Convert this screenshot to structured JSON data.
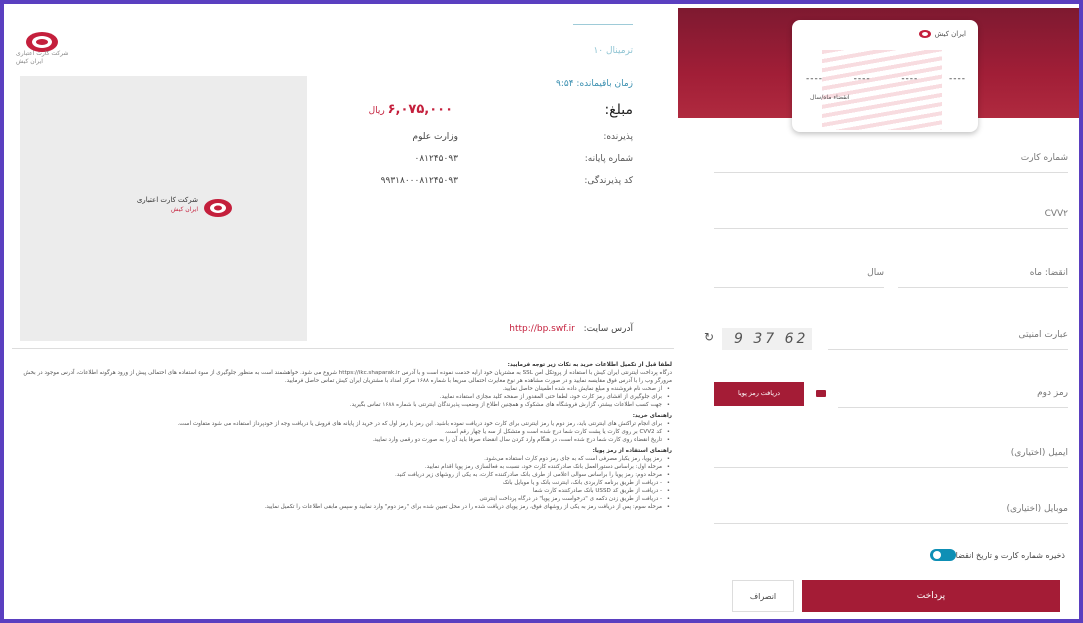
{
  "colors": {
    "brand": "#a41c36",
    "accent": "#0e8fb5",
    "frame": "#5a3fc0"
  },
  "header": {
    "company_lines": [
      "شرکت کارت اعتباری",
      "ایران کیش"
    ]
  },
  "info": {
    "terminal_hint": "ترمینال ۱۰",
    "timer_label": "زمان باقیمانده: ۹:۵۴",
    "amount_label": "مبلغ:",
    "amount_value": "۶,۰۷۵,۰۰۰",
    "amount_unit": "ریال",
    "rows": [
      {
        "label": "پذیرنده:",
        "value": "وزارت علوم"
      },
      {
        "label": "شماره پایانه:",
        "value": "۰۸۱۲۴۵۰۹۳"
      },
      {
        "label": "کد پذیرندگی:",
        "value": "۹۹۳۱۸۰۰۰۸۱۲۴۵۰۹۳"
      }
    ],
    "site_label": "آدرس سایت:",
    "site_url": "http://bp.swf.ir"
  },
  "merchant": {
    "name": "شرکت کارت اعتباری",
    "sub": "ایران کیش"
  },
  "guide": {
    "intro": "لطفا قبل از تکمیل اطلاعات خرید به نکات زیر توجه فرمایید:",
    "p1": "درگاه پرداخت اینترنتی ایران کیش با استفاده از پروتکل امن SSL به مشتریان خود ارایه خدمت نموده است و با آدرس https://ikc.shaparak.ir شروع می شود. خواهشمند است به منظور جلوگیری از سوء استفاده های احتمالی پیش از ورود هرگونه اطلاعات، آدرس موجود در بخش مرورگر وب را با آدرس فوق مقایسه نمایید و در صورت مشاهده هر نوع مغایرت احتمالی سریعا با شماره ۱۶۸۸ مرکز امداد با مشتریان ایران کیش تماس حاصل فرمایید.",
    "bullets1": [
      "از صحت نام فروشنده و مبلغ نمایش داده شده اطمینان حاصل نمایید.",
      "برای جلوگیری از افشای رمز کارت خود، لطفا حتی المقدور از صفحه کلید مجازی استفاده نمایید.",
      "جهت کسب اطلاعات بیشتر، گزارش فروشگاه های مشکوک و همچنین اطلاع از وضعیت پذیرندگان اینترنتی با شماره ۱۶۸۸ تماس بگیرید."
    ],
    "head2": "راهنمای خرید:",
    "bullets2": [
      "برای انجام تراکنش های اینترنتی باید، رمز دوم یا رمز اینترنتی برای کارت خود دریافت نموده باشید. این رمز با رمز اول که در خرید از پایانه های فروش یا دریافت وجه از خودپرداز استفاده می شود متفاوت است.",
      "کد CVV2 بر روی کارت یا پشت کارت شما درج شده است و متشکل از سه یا چهار رقم است.",
      "تاریخ انقضاء روی کارت شما درج شده است، در هنگام وارد کردن سال انقضاء صرفا باید آن را به صورت دو رقمی وارد نمایید."
    ],
    "head3": "راهنمای استفاده از رمز پویا:",
    "bullets3": [
      "رمز پویا، رمز یکبار مصرفی است که به جای رمز دوم کارت استفاده می‌شود.",
      "مرحله اول: براساس دستورالعمل بانک صادرکننده کارت خود، نسبت به فعالسازی رمز پویا اقدام نمایید.",
      "مرحله دوم: رمز پویا را براساس سوالی اعلامی از طرف بانک صادرکننده کارت، به یکی از روشهای زیر دریافت کنید.",
      "- دریافت از طریق برنامه کاربردی بانک، اینترنت بانک و یا موبایل بانک",
      "- دریافت از طریق کد USSD بانک صادرکننده کارت شما",
      "- دریافت از طریق زدن دکمه ی \"درخواست رمز پویا\" در درگاه پرداخت اینترنتی",
      "مرحله سوم: پس از دریافت رمز به یکی از روشهای فوق، رمز پویای دریافت شده را در محل تعیین شده برای \"رمز دوم\" وارد نمایید و سپس مابقی اطلاعات را تکمیل نمایید."
    ]
  },
  "card": {
    "brand": "ایران کیش",
    "digit_groups": [
      "----",
      "----",
      "----",
      "----"
    ],
    "expiry_label": "انقضاء ماه/سال"
  },
  "form": {
    "card_number": "شماره کارت",
    "cvv2": "CVV۲",
    "expiry_month": "انقضا: ماه",
    "expiry_year": "سال",
    "captcha_label": "عبارت امنیتی",
    "captcha_value": "9 37 62",
    "pin2": "رمز دوم",
    "otp_button": "دریافت رمز پویا",
    "email": "ایمیل (اختیاری)",
    "mobile": "موبایل (اختیاری)",
    "save_toggle": "ذخیره شماره کارت و تاریخ انقضا",
    "pay_button": "پرداخت",
    "cancel_button": "انصراف"
  }
}
